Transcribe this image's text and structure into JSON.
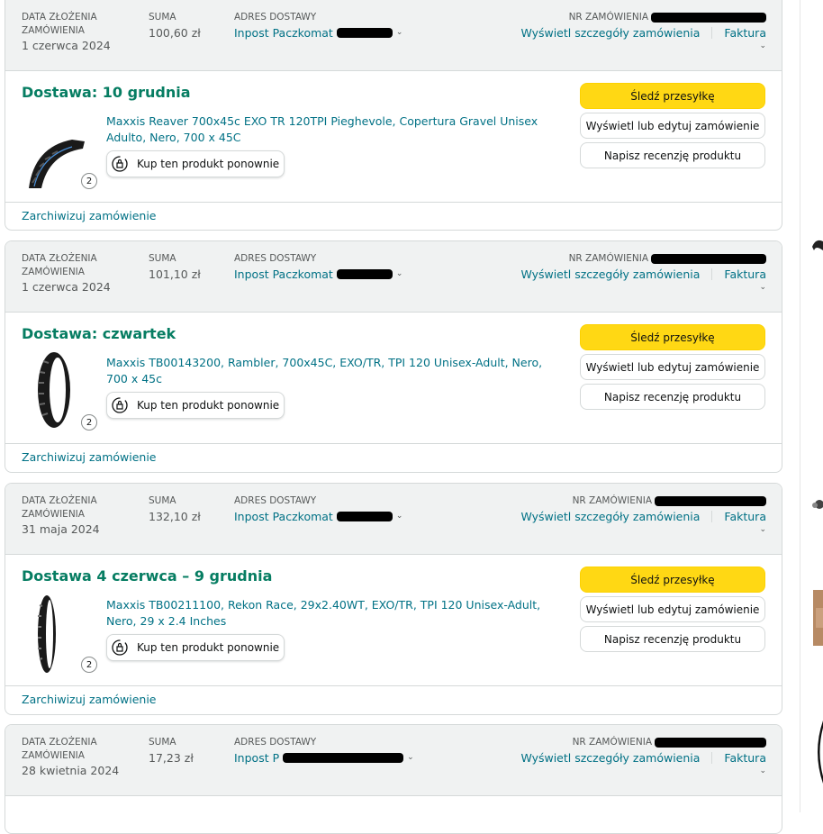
{
  "labels": {
    "date": "DATA ZŁOŻENIA ZAMÓWIENIA",
    "total": "SUMA",
    "address": "ADRES DOSTAWY",
    "order_no": "NR ZAMÓWIENIA",
    "details": "Wyświetl szczegóły zamówienia",
    "invoice": "Faktura",
    "track": "Śledź przesyłkę",
    "edit": "Wyświetl lub edytuj zamówienie",
    "review": "Napisz recenzję produktu",
    "buy_again": "Kup ten produkt ponownie",
    "archive": "Zarchiwizuj zamówienie"
  },
  "colors": {
    "accent_link": "#007185",
    "delivery_green": "#067d62",
    "track_button": "#ffd814",
    "header_bg": "#f0f2f2"
  },
  "orders": [
    {
      "date": "1 czerwca 2024",
      "total": "100,60 zł",
      "address": "Inpost Paczkomat",
      "delivery": "Dostawa: 10 grudnia",
      "title": "Maxxis Reaver 700x45c EXO TR 120TPI Pieghevole, Copertura Gravel Unisex Adulto, Nero, 700 x 45C",
      "qty": "2"
    },
    {
      "date": "1 czerwca 2024",
      "total": "101,10 zł",
      "address": "Inpost Paczkomat",
      "delivery": "Dostawa: czwartek",
      "title": "Maxxis TB00143200, Rambler, 700x45C, EXO/TR, TPI 120 Unisex-Adult, Nero, 700 x 45c",
      "qty": "2"
    },
    {
      "date": "31 maja 2024",
      "total": "132,10 zł",
      "address": "Inpost Paczkomat",
      "delivery": "Dostawa 4 czerwca – 9 grudnia",
      "title": "Maxxis TB00211100, Rekon Race, 29x2.40WT, EXO/TR, TPI 120 Unisex-Adult, Nero, 29 x 2.4 Inches",
      "qty": "2"
    },
    {
      "date": "28 kwietnia 2024",
      "total": "17,23 zł",
      "address": "Inpost P"
    }
  ]
}
